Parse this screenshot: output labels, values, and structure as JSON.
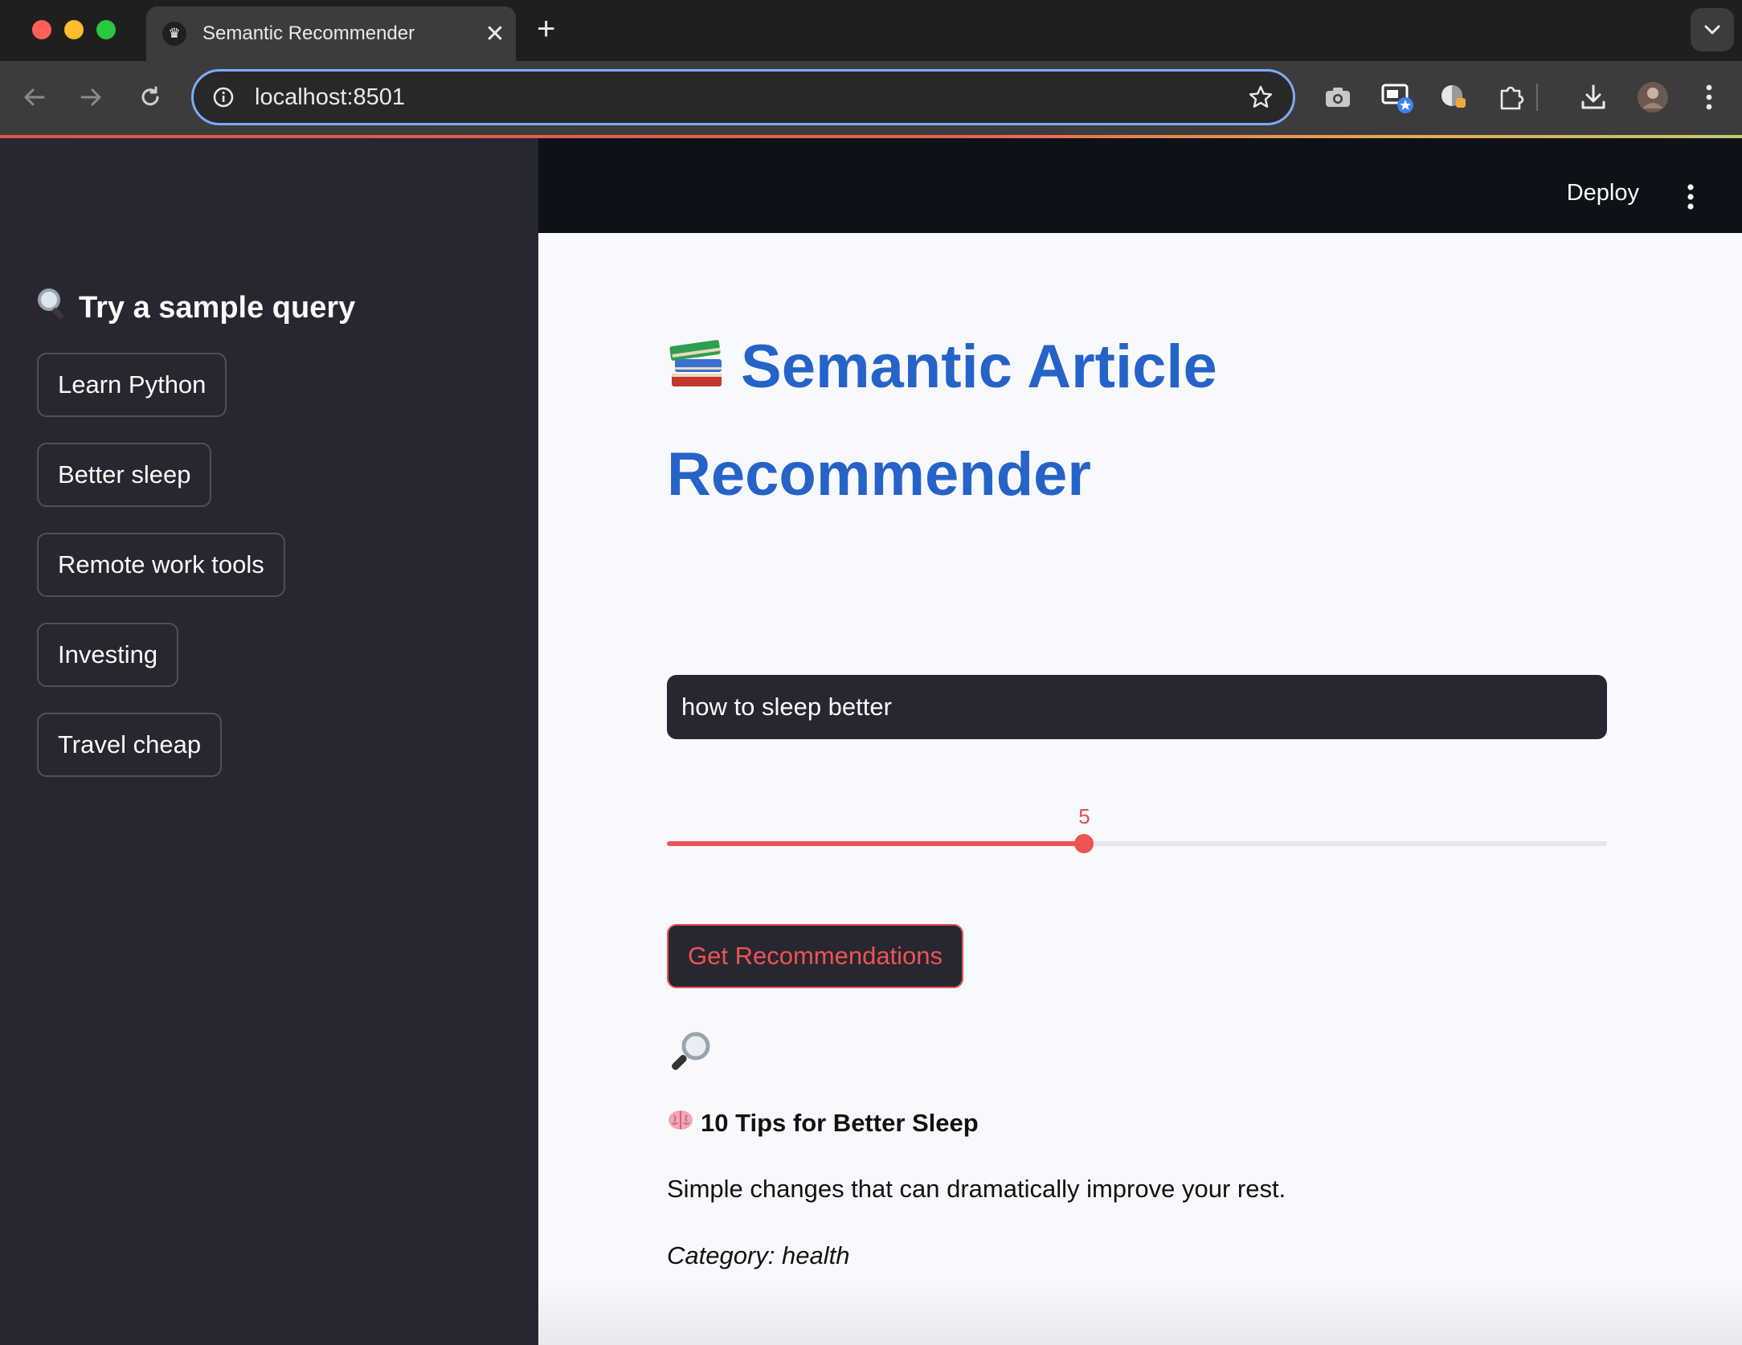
{
  "browser": {
    "tab_title": "Semantic Recommender",
    "tab_close": "✕",
    "new_tab": "+",
    "url": "localhost:8501"
  },
  "header": {
    "deploy_label": "Deploy"
  },
  "sidebar": {
    "heading": "Try a sample query",
    "samples": [
      {
        "label": "Learn Python"
      },
      {
        "label": "Better sleep"
      },
      {
        "label": "Remote work tools"
      },
      {
        "label": "Investing"
      },
      {
        "label": "Travel cheap"
      }
    ]
  },
  "main": {
    "title": "Semantic Article Recommender",
    "query_value": "how to sleep better",
    "slider": {
      "value": "5",
      "fraction": 0.444
    },
    "button_label": "Get Recommendations",
    "result": {
      "title": "10 Tips for Better Sleep",
      "description": "Simple changes that can dramatically improve your rest.",
      "category": "Category: health"
    }
  },
  "colors": {
    "accent": "#ee5352",
    "title_blue": "#2563c9",
    "sidebar_bg": "#262730",
    "header_bg": "#0e1117"
  },
  "icons": [
    "crown-favicon-icon",
    "back-arrow-icon",
    "forward-arrow-icon",
    "reload-icon",
    "info-icon",
    "star-icon",
    "camera-icon",
    "picture-in-picture-icon",
    "extension-icon",
    "puzzle-icon",
    "download-icon",
    "avatar",
    "more-vertical-icon",
    "magnifier-icon",
    "books-icon",
    "brain-icon"
  ]
}
